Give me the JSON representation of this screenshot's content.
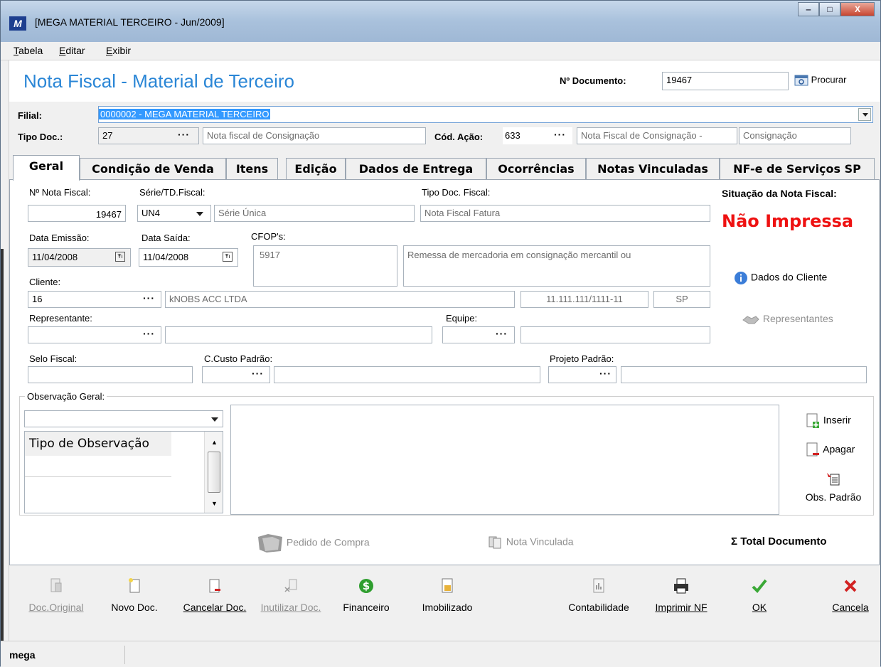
{
  "window": {
    "title": "[MEGA MATERIAL TERCEIRO - Jun/2009]",
    "logo": "M",
    "minimize": "‒",
    "maximize": "□",
    "close": "X"
  },
  "menu": [
    "Tabela",
    "Editar",
    "Exibir"
  ],
  "header": {
    "title": "Nota Fiscal - Material de Terceiro",
    "doc_label": "Nº Documento:",
    "doc_value": "19467",
    "search_label": "Procurar"
  },
  "filial": {
    "label": "Filial:",
    "value": "0000002 - MEGA MATERIAL TERCEIRO"
  },
  "tipo_doc": {
    "label": "Tipo Doc.:",
    "code": "27",
    "dots": "···",
    "description": "Nota fiscal de Consignação"
  },
  "cod_acao": {
    "label": "Cód. Ação:",
    "code": "633",
    "dots": "···",
    "description": "Nota Fiscal de Consignação -",
    "extra": "Consignação"
  },
  "tabs": [
    "Geral",
    "Condição de Venda",
    "Itens",
    "Edição",
    "Dados de Entrega",
    "Ocorrências",
    "Notas Vinculadas",
    "NF-e de Serviços SP"
  ],
  "active_tab": "Geral",
  "geral": {
    "nf_label": "Nº Nota Fiscal:",
    "nf_value": "19467",
    "serie_label": "Série/TD.Fiscal:",
    "serie_value": "UN4",
    "serie_desc": "Série Única",
    "tipo_fiscal_label": "Tipo Doc. Fiscal:",
    "tipo_fiscal_value": "Nota Fiscal Fatura",
    "situacao_label": "Situação da Nota Fiscal:",
    "situacao_value": "Não Impressa",
    "emissao_label": "Data Emissão:",
    "emissao_value": "11/04/2008",
    "saida_label": "Data Saída:",
    "saida_value": "11/04/2008",
    "cfop_label": "CFOP's:",
    "cfop_value": "5917",
    "cfop_desc": "Remessa de mercadoria em consignação mercantil ou",
    "cliente_label": "Cliente:",
    "cliente_code": "16",
    "cliente_name": "kNOBS ACC LTDA",
    "cliente_cnpj": "11.111.111/1111-11",
    "cliente_uf": "SP",
    "dados_cliente": "Dados do Cliente",
    "representante_label": "Representante:",
    "equipe_label": "Equipe:",
    "representantes_btn": "Representantes",
    "selo_label": "Selo Fiscal:",
    "ccusto_label": "C.Custo Padrão:",
    "projeto_label": "Projeto Padrão:",
    "dots": "···",
    "cal_icon": "Ŧı"
  },
  "observacao": {
    "group_label": "Observação Geral:",
    "list_header": "Tipo de Observação",
    "inserir": "Inserir",
    "apagar": "Apagar",
    "obs_padrao": "Obs. Padrão"
  },
  "links": {
    "pedido_compra": "Pedido de Compra",
    "nota_vinculada": "Nota Vinculada",
    "total_documento": "Total Documento",
    "sigma": "Σ"
  },
  "toolbar": [
    {
      "label": "Doc.Original",
      "icon": "doc-icon",
      "enabled": false
    },
    {
      "label": "Novo Doc.",
      "icon": "new-doc-icon",
      "enabled": true
    },
    {
      "label": "Cancelar Doc.",
      "icon": "cancel-doc-icon",
      "enabled": true
    },
    {
      "label": "Inutilizar Doc.",
      "icon": "disable-doc-icon",
      "enabled": false
    },
    {
      "label": "Financeiro",
      "icon": "dollar-icon",
      "enabled": true
    },
    {
      "label": "Imobilizado",
      "icon": "asset-icon",
      "enabled": true
    },
    {
      "label": "Contabilidade",
      "icon": "accounting-icon",
      "enabled": true
    },
    {
      "label": "Imprimir NF",
      "icon": "printer-icon",
      "enabled": true
    },
    {
      "label": "OK",
      "icon": "check-icon",
      "enabled": true
    },
    {
      "label": "Cancela",
      "icon": "x-icon",
      "enabled": true
    }
  ],
  "statusbar": {
    "user": "mega"
  },
  "colors": {
    "title_blue": "#2a86d6",
    "status_red": "#ee1111",
    "ok_green": "#3aa836",
    "cancel_red": "#d22222",
    "dollar_green": "#2f9e2f"
  }
}
